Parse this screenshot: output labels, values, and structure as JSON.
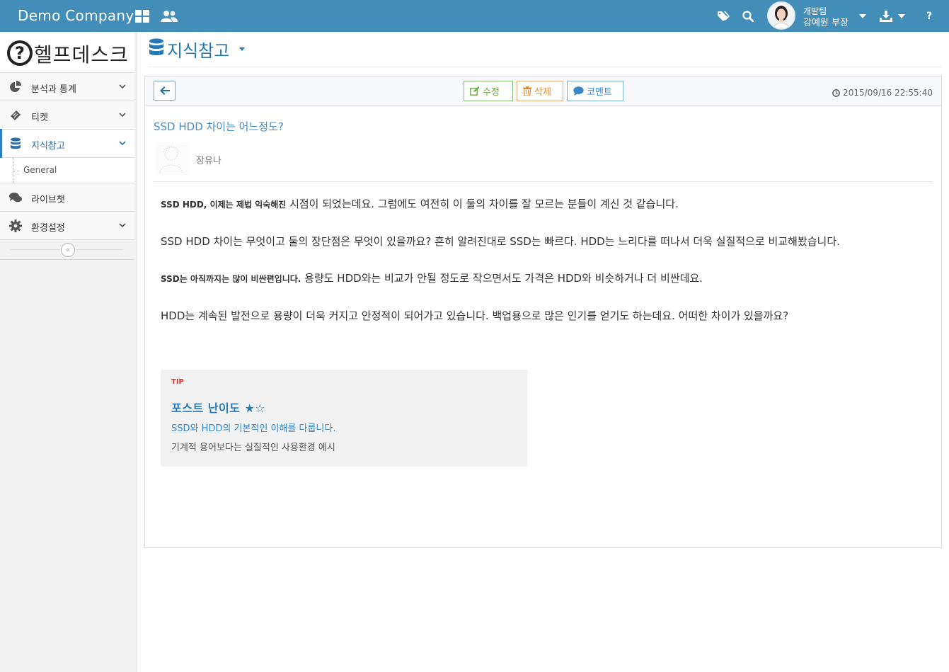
{
  "header": {
    "brand": "Demo Company",
    "user_team": "개발팀",
    "user_name": "강예원 부장"
  },
  "sidebar": {
    "logo_text": "헬프데스크",
    "items": [
      {
        "label": "분석과 통계",
        "icon": "pie-chart-icon"
      },
      {
        "label": "티켓",
        "icon": "ticket-icon"
      },
      {
        "label": "지식참고",
        "icon": "database-icon",
        "active": true
      },
      {
        "label": "라이브챗",
        "icon": "comments-icon"
      },
      {
        "label": "환경설정",
        "icon": "gear-icon"
      }
    ],
    "sub_item": "General"
  },
  "page": {
    "title": "지식참고"
  },
  "toolbar": {
    "edit_label": "수정",
    "delete_label": "삭제",
    "comment_label": "코멘트",
    "date": "2015/09/16 22:55:40"
  },
  "post": {
    "title": "SSD HDD 차이는 어느정도?",
    "author": "장유나",
    "p1_bold": "SSD HDD, 이제는 제법 익숙해진",
    "p1_rest": " 시점이 되었는데요. 그럼에도 여전히 이 둘의 차이를 잘 모르는 분들이 계신 것 같습니다.",
    "p2": "SSD HDD 차이는 무엇이고 둘의 장단점은 무엇이 있을까요? 흔히 알려진대로 SSD는 빠르다. HDD는 느리다를 떠나서 더욱 실질적으로 비교해봤습니다.",
    "p3_bold": "SSD는 아직까지는 많이 비싼편입니다.",
    "p3_rest": " 용량도 HDD와는 비교가 안될 정도로 작으면서도 가격은 HDD와 비슷하거나 더 비싼데요.",
    "p4": "HDD는 계속된 발전으로 용량이 더욱 커지고 안정적이 되어가고 있습니다. 백업용으로 많은 인기를 얻기도 하는데요. 어떠한 차이가 있을까요?"
  },
  "tip": {
    "label": "TIP",
    "title": "포스트 난이도 ★☆",
    "line1": "SSD와 HDD의 기본적인 이해를 다룹니다.",
    "line2": "기계적 용어보다는 실질적인 사용환경 예시"
  },
  "colors": {
    "topbar": "#438eb9",
    "accent": "#2679b5",
    "edit": "#69aa46",
    "delete": "#e08b36",
    "tip_label": "#dd3333"
  }
}
